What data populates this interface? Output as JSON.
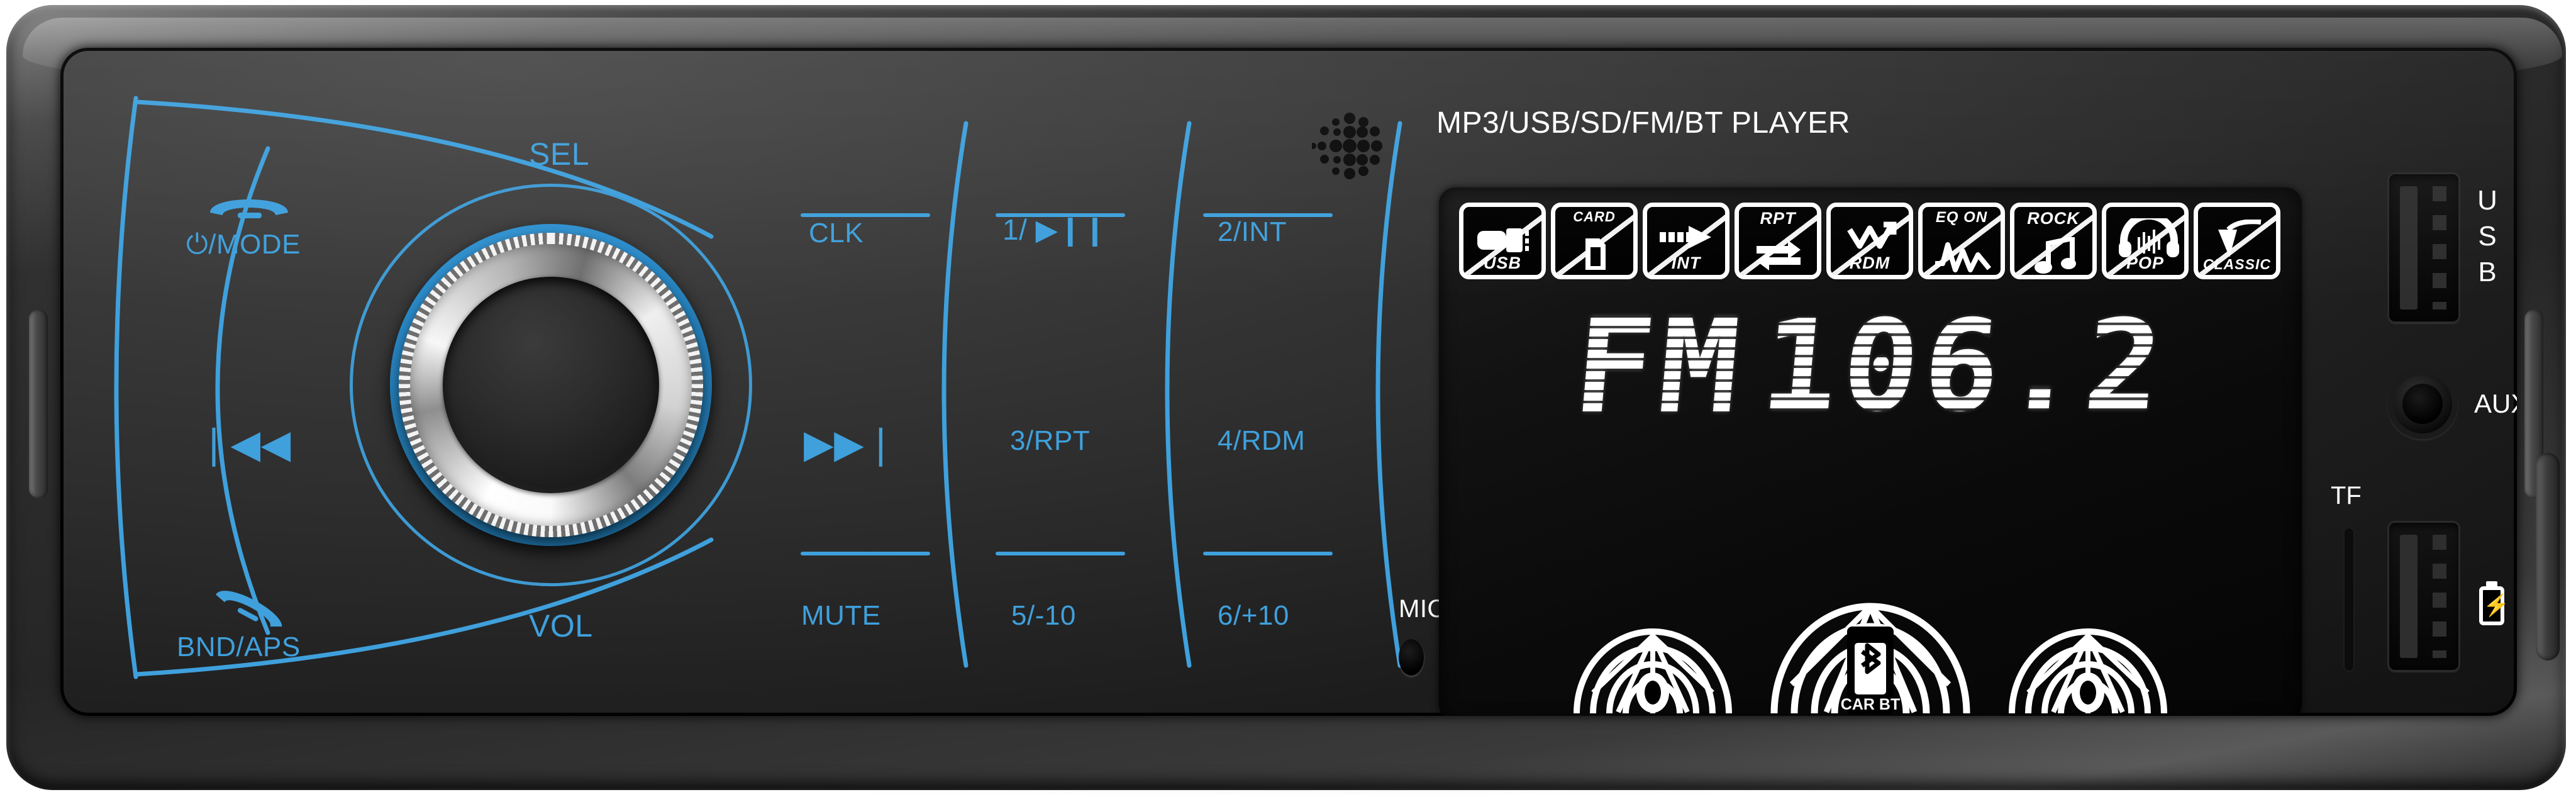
{
  "device": {
    "brand_text": "MP3/USB/SD/FM/BT PLAYER",
    "accent_color": "#3fa0dc",
    "panel_color": "#2c2c2c",
    "lcd_color": "#ffffff"
  },
  "controls": {
    "knob": {
      "label_top": "SEL",
      "label_bottom": "VOL",
      "name": "volume-select-knob"
    },
    "power_mode": {
      "label": "⏻/MODE",
      "icon": "phone-answer-icon"
    },
    "band_aps": {
      "label": "BND/APS",
      "icon": "phone-hangup-icon"
    },
    "prev_track": {
      "label": "❘◀◀",
      "name": "previous-track"
    },
    "next_track": {
      "label": "▶▶❘",
      "name": "next-track"
    },
    "clock": {
      "label": "CLK"
    },
    "mute": {
      "label": "MUTE"
    },
    "preset1": {
      "label": "1/ ▶❙❙"
    },
    "preset2": {
      "label": "2/INT"
    },
    "preset3": {
      "label": "3/RPT"
    },
    "preset4": {
      "label": "4/RDM"
    },
    "preset5": {
      "label": "5/-10"
    },
    "preset6": {
      "label": "6/+10"
    },
    "mic": {
      "label": "MIC"
    }
  },
  "ports": {
    "usb_top": {
      "label": "USB",
      "letters": [
        "U",
        "S",
        "B"
      ]
    },
    "aux": {
      "label": "AUX"
    },
    "tf": {
      "label": "TF"
    },
    "charge": {
      "icon": "battery-charging-icon",
      "glyph": "⚡"
    }
  },
  "lcd": {
    "indicators": [
      {
        "id": "usb",
        "top": "",
        "bottom": "USB",
        "glyph": "⬚"
      },
      {
        "id": "card",
        "top": "CARD",
        "bottom": "",
        "glyph": "▯"
      },
      {
        "id": "int",
        "top": "",
        "bottom": "INT",
        "glyph": "▶"
      },
      {
        "id": "rpt",
        "top": "RPT",
        "bottom": "",
        "glyph": "⇄"
      },
      {
        "id": "rdm",
        "top": "",
        "bottom": "RDM",
        "glyph": "⤨"
      },
      {
        "id": "eq-on",
        "top": "EQ ON",
        "bottom": "",
        "glyph": "⌇"
      },
      {
        "id": "rock",
        "top": "ROCK",
        "bottom": "",
        "glyph": "♫"
      },
      {
        "id": "pop",
        "top": "",
        "bottom": "POP",
        "glyph": "Ἲ7"
      },
      {
        "id": "classic",
        "top": "",
        "bottom": "CLASSIC",
        "glyph": "√"
      }
    ],
    "band": "FM",
    "frequency": "106.2",
    "bluetooth_name": "CAR BT",
    "visualizers": 3
  }
}
